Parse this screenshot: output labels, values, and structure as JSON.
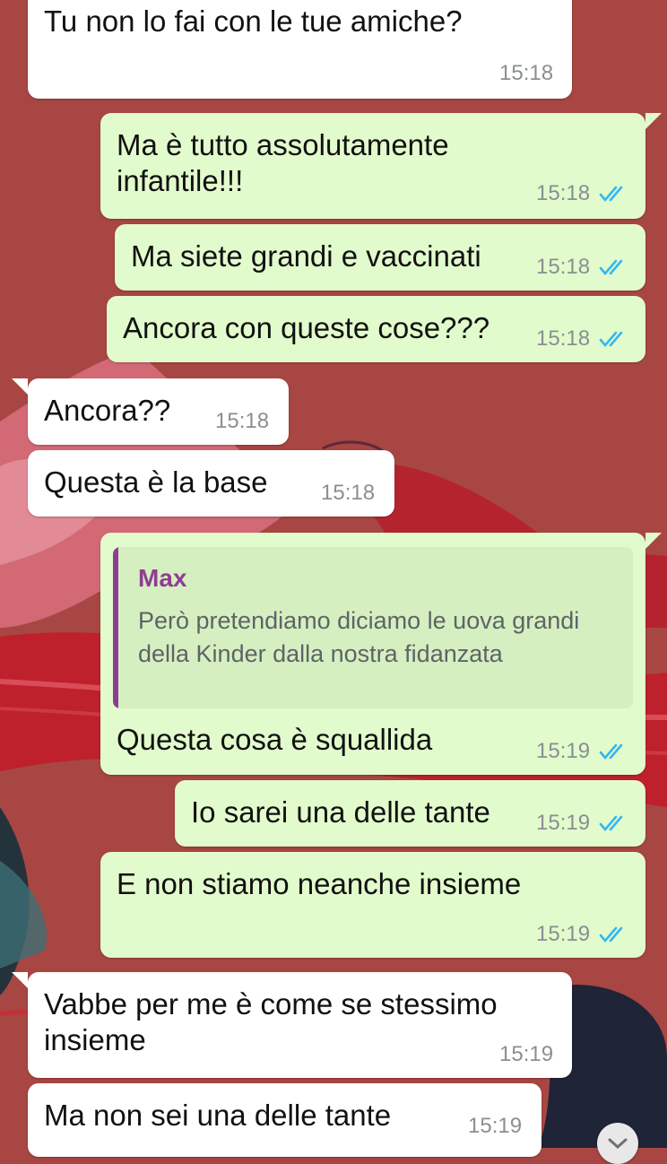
{
  "messages": [
    {
      "direction": "in",
      "text": "Tu non lo fai con le tue amiche?",
      "time": "15:18"
    },
    {
      "direction": "out",
      "text": "Ma è tutto assolutamente infantile!!!",
      "time": "15:18",
      "read": true
    },
    {
      "direction": "out",
      "text": "Ma siete grandi e vaccinati",
      "time": "15:18",
      "read": true
    },
    {
      "direction": "out",
      "text": "Ancora con queste cose???",
      "time": "15:18",
      "read": true
    },
    {
      "direction": "in",
      "text": "Ancora??",
      "time": "15:18"
    },
    {
      "direction": "in",
      "text": "Questa è la base",
      "time": "15:18"
    },
    {
      "direction": "out",
      "text": "Questa cosa è squallida",
      "time": "15:19",
      "read": true,
      "reply_to": {
        "author": "Max",
        "text": "Però pretendiamo diciamo le uova grandi della Kinder dalla nostra fidanzata"
      }
    },
    {
      "direction": "out",
      "text": "Io sarei una delle tante",
      "time": "15:19",
      "read": true
    },
    {
      "direction": "out",
      "text": "E non stiamo neanche insieme",
      "time": "15:19",
      "read": true
    },
    {
      "direction": "in",
      "text": "Vabbe per me è come se stessimo insieme",
      "time": "15:19"
    },
    {
      "direction": "in",
      "text": "Ma non sei una delle tante",
      "time": "15:19"
    }
  ],
  "colors": {
    "incoming_bubble": "#ffffff",
    "outgoing_bubble": "#e2fbcc",
    "read_ticks": "#34b7f1",
    "reply_author": "#8e3e92",
    "wallpaper": "#a84643"
  },
  "icons": {
    "read_receipt": "double-check-icon",
    "scroll": "chevron-down-icon"
  }
}
